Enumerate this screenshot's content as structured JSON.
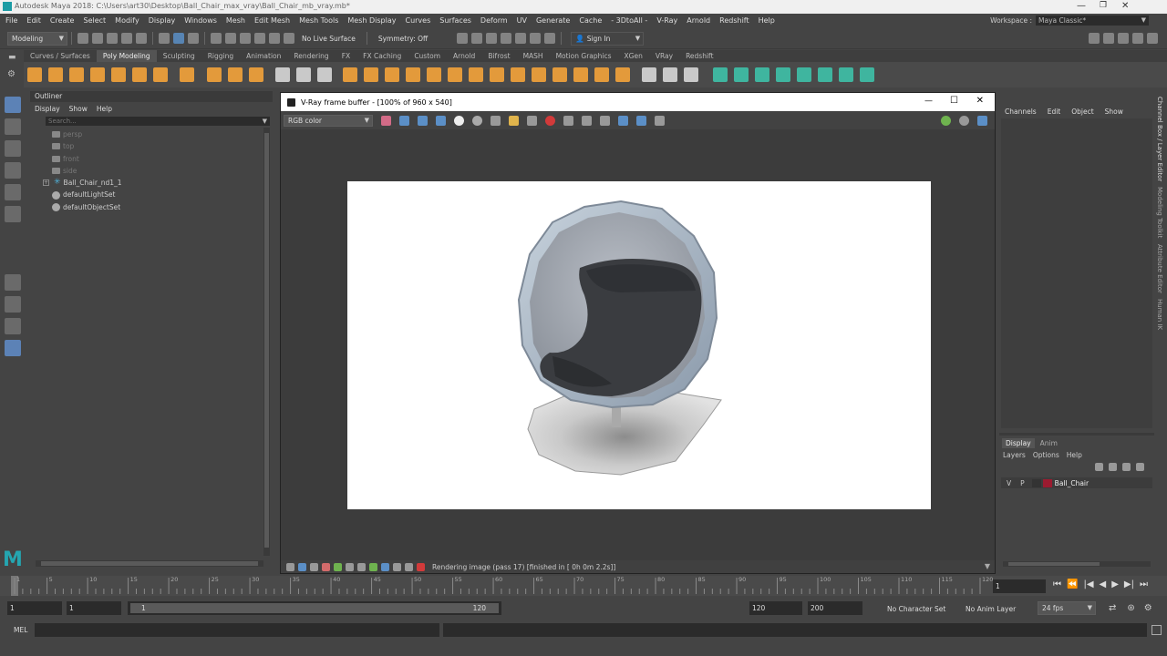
{
  "window": {
    "title": "Autodesk Maya 2018: C:\\Users\\art30\\Desktop\\Ball_Chair_max_vray\\Ball_Chair_mb_vray.mb*"
  },
  "menubar": {
    "items": [
      "File",
      "Edit",
      "Create",
      "Select",
      "Modify",
      "Display",
      "Windows",
      "Mesh",
      "Edit Mesh",
      "Mesh Tools",
      "Mesh Display",
      "Curves",
      "Surfaces",
      "Deform",
      "UV",
      "Generate",
      "Cache",
      "- 3DtoAll -",
      "V-Ray",
      "Arnold",
      "Redshift",
      "Help"
    ],
    "workspace_label": "Workspace :",
    "workspace_value": "Maya Classic*"
  },
  "statusline": {
    "mode": "Modeling",
    "live_surface": "No Live Surface",
    "symmetry": "Symmetry: Off",
    "sign_in": "Sign In"
  },
  "shelf": {
    "tabs": [
      "Curves / Surfaces",
      "Poly Modeling",
      "Sculpting",
      "Rigging",
      "Animation",
      "Rendering",
      "FX",
      "FX Caching",
      "Custom",
      "Arnold",
      "Bifrost",
      "MASH",
      "Motion Graphics",
      "XGen",
      "VRay",
      "Redshift"
    ],
    "active_tab": "Poly Modeling"
  },
  "outliner": {
    "title": "Outliner",
    "menu": [
      "Display",
      "Show",
      "Help"
    ],
    "search_placeholder": "Search...",
    "items": [
      {
        "label": "persp",
        "dim": true,
        "icon": "camera-icon"
      },
      {
        "label": "top",
        "dim": true,
        "icon": "camera-icon"
      },
      {
        "label": "front",
        "dim": true,
        "icon": "camera-icon"
      },
      {
        "label": "side",
        "dim": true,
        "icon": "camera-icon"
      },
      {
        "label": "Ball_Chair_nd1_1",
        "dim": false,
        "icon": "group-icon"
      },
      {
        "label": "defaultLightSet",
        "dim": false,
        "icon": "set-icon"
      },
      {
        "label": "defaultObjectSet",
        "dim": false,
        "icon": "set-icon"
      }
    ]
  },
  "vfb": {
    "title": "V-Ray frame buffer - [100% of 960 x 540]",
    "channel": "RGB color",
    "status": "Rendering image (pass 17) [finished in [ 0h  0m  2.2s]]"
  },
  "channelbox": {
    "menu": [
      "Channels",
      "Edit",
      "Object",
      "Show"
    ],
    "vertical_tabs": [
      "Channel Box / Layer Editor",
      "Modeling Toolkit",
      "Attribute Editor",
      "Human IK"
    ],
    "layer_tabs": [
      "Display",
      "Anim"
    ],
    "layer_menu": [
      "Layers",
      "Options",
      "Help"
    ],
    "layer": {
      "v": "V",
      "p": "P",
      "name": "Ball_Chair",
      "color": "#9b1b30"
    }
  },
  "timeline": {
    "ticks": [
      "1",
      "5",
      "10",
      "15",
      "20",
      "25",
      "30",
      "35",
      "40",
      "45",
      "50",
      "55",
      "60",
      "65",
      "70",
      "75",
      "80",
      "85",
      "90",
      "95",
      "100",
      "105",
      "110",
      "115",
      "120"
    ],
    "current_frame": "1"
  },
  "range": {
    "start": "1",
    "anim_start": "1",
    "slider_start": "1",
    "slider_end": "120",
    "end": "120",
    "anim_end": "200",
    "character_set": "No Character Set",
    "anim_layer": "No Anim Layer",
    "fps": "24 fps"
  },
  "cmdline": {
    "label": "MEL"
  },
  "colors": {
    "accent": "#5c82b6",
    "shelf_orange": "#e39a3b",
    "shelf_green": "#3fb59f"
  }
}
